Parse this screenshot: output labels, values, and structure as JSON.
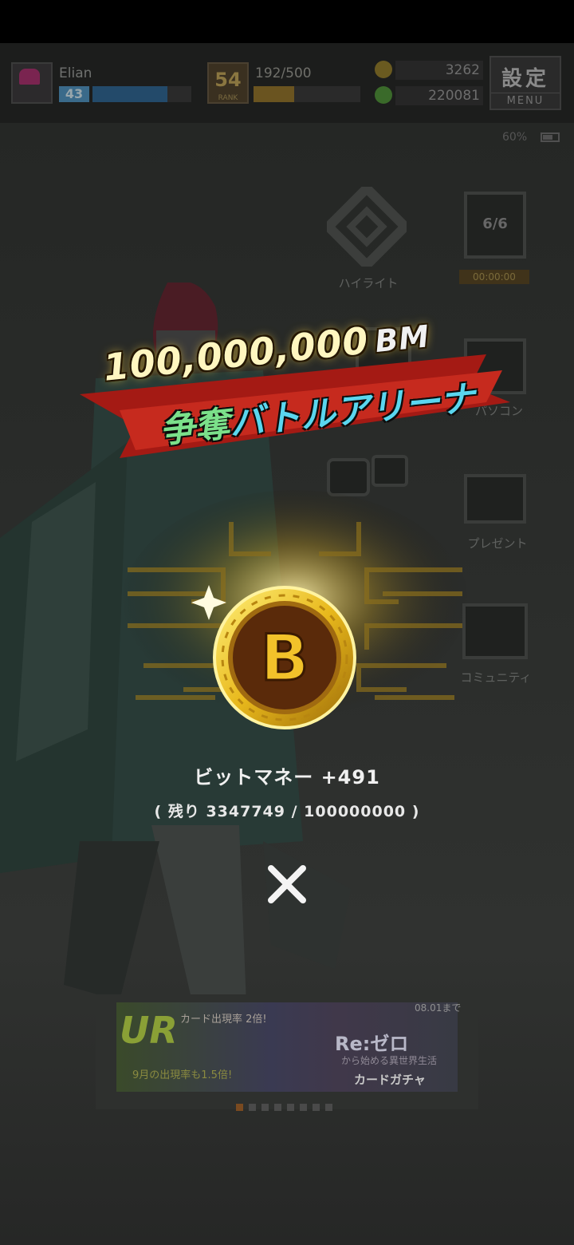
{
  "hud": {
    "player_name": "Elian",
    "player_level": "43",
    "level_progress": 0.76,
    "rank_badge": "54",
    "rank_label": "RANK",
    "stamina": "192/500",
    "stamina_progress": 0.38,
    "currency_1": "3262",
    "currency_2": "220081",
    "settings_kanji": "設定",
    "settings_menu": "MENU",
    "battery": "60%"
  },
  "menu": {
    "highlight_label": "ハイライト",
    "card_count": "6/6",
    "card_timer": "00:00:00",
    "pasocon_label": "パソコン",
    "present_label": "プレゼント",
    "community_label": "コミュニティ"
  },
  "banner": {
    "amount": "100,000,000",
    "unit": "BM",
    "subtitle_a": "争奪",
    "subtitle_b": "バトルアリーナ"
  },
  "reward": {
    "coin_letter": "B",
    "line": "ビットマネー +491",
    "remaining": "( 残り 3347749 / 100000000 )"
  },
  "ad": {
    "ur_text": "UR",
    "card_text": "カード出現率 2倍!",
    "rate_text": "9月の出現率も1.5倍!",
    "date_text": "08.01まで",
    "rezero_text": "Re:ゼロ",
    "sub_text": "から始める異世界生活",
    "gacha_text": "カードガチャ",
    "dot_count": 8,
    "active_dot": 0
  },
  "colors": {
    "gold": "#e8b81c",
    "coin_dark": "#5a2a0a",
    "banner_red": "#c0251c"
  }
}
